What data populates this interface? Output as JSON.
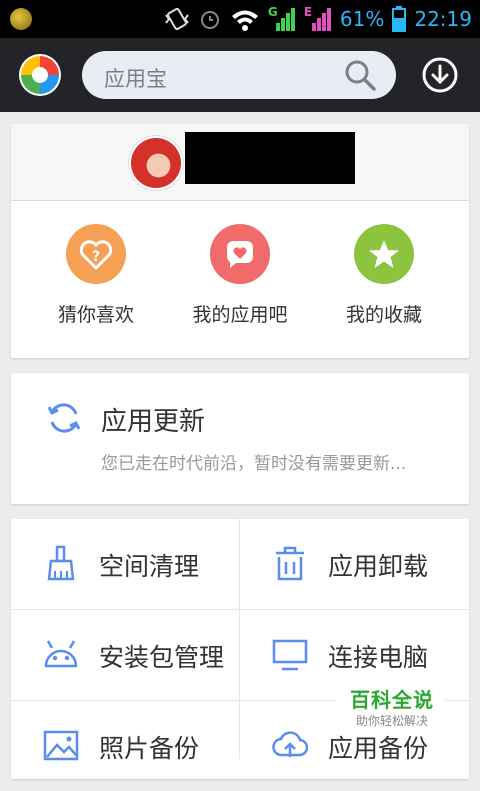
{
  "status_bar": {
    "battery": "61%",
    "time": "22:19",
    "net_g": "G",
    "net_e": "E"
  },
  "search": {
    "placeholder": "应用宝"
  },
  "quick_actions": [
    {
      "label": "猜你喜欢",
      "icon": "question-heart-icon",
      "color": "#f5a054"
    },
    {
      "label": "我的应用吧",
      "icon": "chat-heart-icon",
      "color": "#f26b6b"
    },
    {
      "label": "我的收藏",
      "icon": "star-icon",
      "color": "#8cc43f"
    }
  ],
  "update": {
    "title": "应用更新",
    "subtitle": "您已走在时代前沿，暂时没有需要更新..."
  },
  "tools": [
    {
      "label": "空间清理",
      "icon": "broom-icon"
    },
    {
      "label": "应用卸载",
      "icon": "trash-icon"
    },
    {
      "label": "安装包管理",
      "icon": "android-icon"
    },
    {
      "label": "连接电脑",
      "icon": "monitor-icon"
    },
    {
      "label": "照片备份",
      "icon": "photo-icon"
    },
    {
      "label": "应用备份",
      "icon": "cloud-upload-icon"
    }
  ],
  "watermark": {
    "title": "百科全说",
    "subtitle": "助你轻松解决"
  },
  "colors": {
    "accent_blue": "#5b8def",
    "status_blue": "#29b6f6"
  }
}
